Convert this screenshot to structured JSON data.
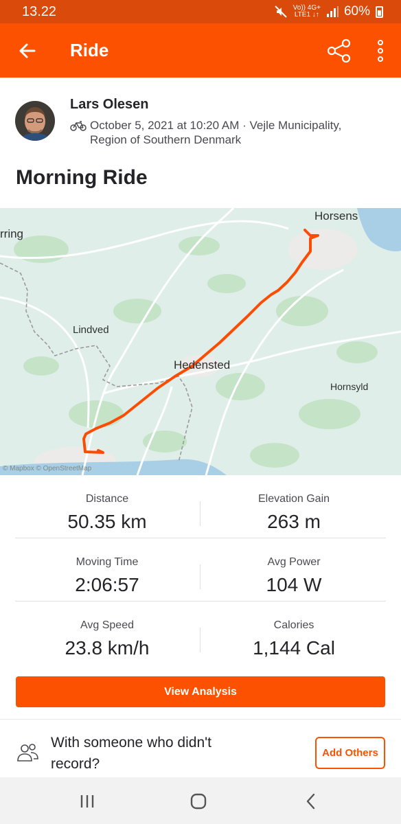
{
  "status_bar": {
    "time": "13.22",
    "network_top": "Vo)) 4G+",
    "network_bottom": "LTE1 ↓↑",
    "battery": "60%",
    "icons": [
      "mute-icon",
      "signal-icon",
      "battery-icon"
    ]
  },
  "app_bar": {
    "title": "Ride",
    "back_icon": "arrow-left-icon",
    "share_icon": "share-icon",
    "menu_icon": "more-vertical-icon"
  },
  "athlete": {
    "name": "Lars Olesen",
    "meta_line1": "October 5, 2021 at 10:20 AM · Vejle Municipality,",
    "meta_line2": "Region of Southern Denmark",
    "sport_icon": "bike-icon"
  },
  "activity": {
    "title": "Morning Ride"
  },
  "map": {
    "labels": [
      "Horsens",
      "rring",
      "Lindved",
      "Hedensted",
      "Hornsyld"
    ],
    "attribution": "© Mapbox © OpenStreetMap",
    "route_color": "#fc4c02"
  },
  "stats": [
    {
      "left_label": "Distance",
      "left_value": "50.35 km",
      "right_label": "Elevation Gain",
      "right_value": "263 m"
    },
    {
      "left_label": "Moving Time",
      "left_value": "2:06:57",
      "right_label": "Avg Power",
      "right_value": "104 W"
    },
    {
      "left_label": "Avg Speed",
      "left_value": "23.8 km/h",
      "right_label": "Calories",
      "right_value": "1,144 Cal"
    }
  ],
  "actions": {
    "view_analysis": "View Analysis",
    "others_text_line1": "With someone who didn't",
    "others_text_line2": "record?",
    "add_others": "Add Others"
  },
  "colors": {
    "brand": "#fc5200",
    "status_bar": "#d94a0b"
  }
}
